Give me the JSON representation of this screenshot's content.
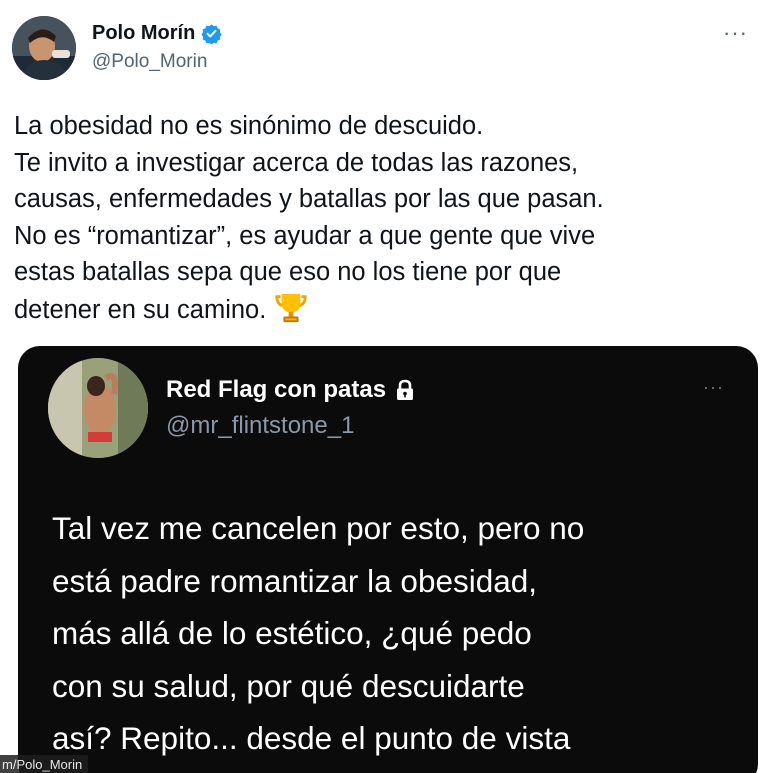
{
  "tweet": {
    "author": {
      "display_name": "Polo Morín",
      "handle": "@Polo_Morin",
      "verified": true
    },
    "more_icon": "more-horizontal-icon",
    "text_lines": [
      "La obesidad no es sinónimo de descuido.",
      "Te invito a investigar acerca de todas las razones,",
      "causas, enfermedades y batallas por las que pasan.",
      "No es “romantizar”, es ayudar a que gente que vive",
      "estas batallas sepa que eso no los tiene por que",
      "detener en su camino."
    ],
    "emoji": "trophy-icon"
  },
  "quoted_tweet": {
    "author": {
      "display_name": "Red Flag con patas",
      "handle": "@mr_flintstone_1",
      "protected": true
    },
    "more_icon": "more-horizontal-icon",
    "text_lines": [
      "Tal vez me cancelen por esto, pero no",
      "está padre romantizar la obesidad,",
      "más allá de lo estético, ¿qué pedo",
      "con su salud, por qué descuidarte",
      "así? Repito... desde el punto de vista"
    ]
  },
  "watermark": "m/Polo_Morin",
  "colors": {
    "verified_blue": "#1d9bf0",
    "text_primary": "#0f1419",
    "text_secondary": "#536471",
    "quote_background": "#0b0b0b",
    "quote_handle": "#8b98a5"
  }
}
